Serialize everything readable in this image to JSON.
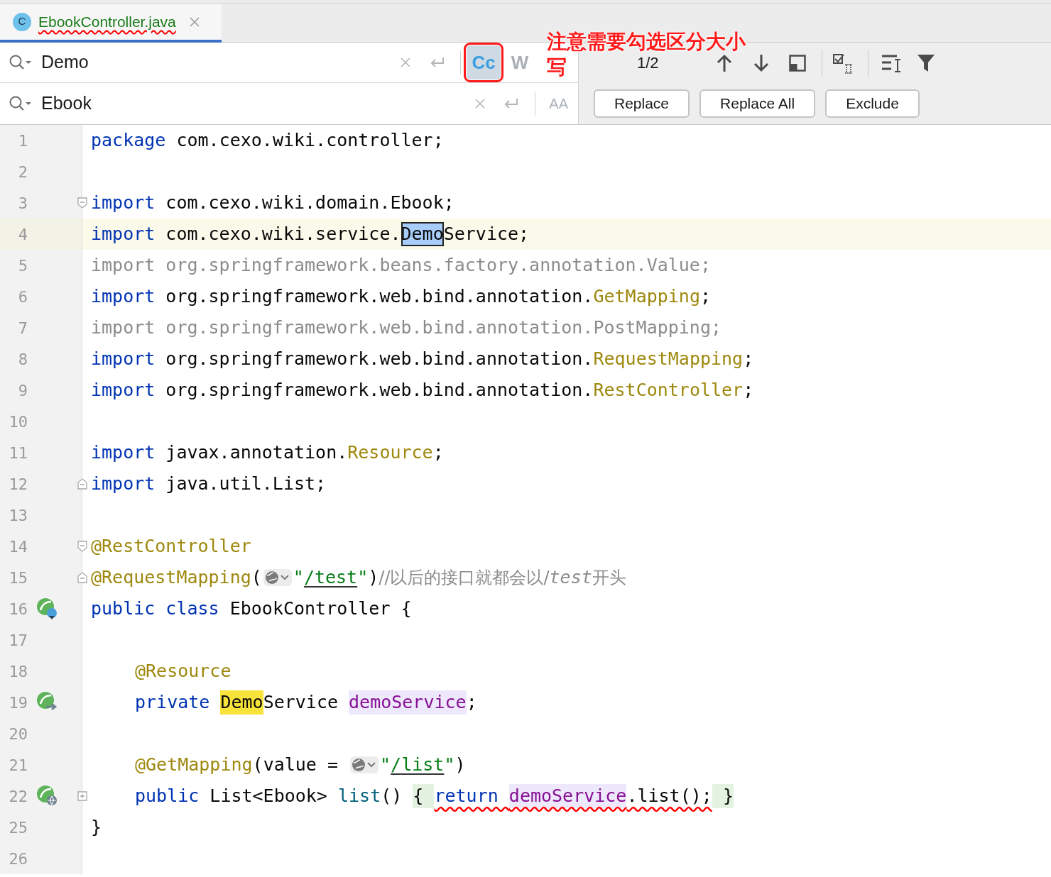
{
  "tab": {
    "icon_letter": "C",
    "label": "EbookController.java",
    "selected": true,
    "squiggle": true
  },
  "search": {
    "value": "Demo",
    "matches": "1/2",
    "options": [
      {
        "label": "Cc",
        "selected": true,
        "outlined": true
      },
      {
        "label": "W",
        "selected": false,
        "outlined": false
      }
    ]
  },
  "replace": {
    "value": "Ebook",
    "preserve_case_label": "AA"
  },
  "buttons": [
    "Replace",
    "Replace All",
    "Exclude"
  ],
  "annotation_lines": [
    "注意需要勾选区分大小",
    "写"
  ],
  "lines": [
    {
      "n": "1",
      "tokens": [
        {
          "text": "package ",
          "kind": "kw"
        },
        {
          "text": "com.cexo.wiki.controller;",
          "kind": "plain"
        }
      ]
    },
    {
      "n": "2"
    },
    {
      "n": "3",
      "fold": {
        "kind": "start"
      },
      "tokens": [
        {
          "text": "import ",
          "kind": "kw"
        },
        {
          "text": "com.cexo.wiki.domain.Ebook;",
          "kind": "plain"
        }
      ]
    },
    {
      "n": "4",
      "current": true,
      "tokens": [
        {
          "text": "import ",
          "kind": "kw"
        },
        {
          "text": "com.cexo.wiki.service.",
          "kind": "plain"
        },
        {
          "text": "Demo",
          "kind": "current-match"
        },
        {
          "text": "Service;",
          "kind": "plain"
        }
      ]
    },
    {
      "n": "5",
      "tokens": [
        {
          "text": "import org.springframework.beans.factory.annotation.Value;",
          "kind": "dim"
        }
      ]
    },
    {
      "n": "6",
      "tokens": [
        {
          "text": "import ",
          "kind": "kw"
        },
        {
          "text": "org.springframework.web.bind.annotation.",
          "kind": "plain"
        },
        {
          "text": "GetMapping",
          "kind": "ann"
        },
        {
          "text": ";",
          "kind": "plain"
        }
      ]
    },
    {
      "n": "7",
      "tokens": [
        {
          "text": "import org.springframework.web.bind.annotation.PostMapping;",
          "kind": "dim"
        }
      ]
    },
    {
      "n": "8",
      "tokens": [
        {
          "text": "import ",
          "kind": "kw"
        },
        {
          "text": "org.springframework.web.bind.annotation.",
          "kind": "plain"
        },
        {
          "text": "RequestMapping",
          "kind": "ann"
        },
        {
          "text": ";",
          "kind": "plain"
        }
      ]
    },
    {
      "n": "9",
      "tokens": [
        {
          "text": "import ",
          "kind": "kw"
        },
        {
          "text": "org.springframework.web.bind.annotation.",
          "kind": "plain"
        },
        {
          "text": "RestController",
          "kind": "ann"
        },
        {
          "text": ";",
          "kind": "plain"
        }
      ]
    },
    {
      "n": "10"
    },
    {
      "n": "11",
      "tokens": [
        {
          "text": "import ",
          "kind": "kw"
        },
        {
          "text": "javax.annotation.",
          "kind": "plain"
        },
        {
          "text": "Resource",
          "kind": "ann"
        },
        {
          "text": ";",
          "kind": "plain"
        }
      ]
    },
    {
      "n": "12",
      "fold": {
        "kind": "end"
      },
      "tokens": [
        {
          "text": "import ",
          "kind": "kw"
        },
        {
          "text": "java.util.List;",
          "kind": "plain"
        }
      ]
    },
    {
      "n": "13"
    },
    {
      "n": "14",
      "fold": {
        "kind": "start"
      },
      "tokens": [
        {
          "text": "@RestController",
          "kind": "ann"
        }
      ]
    },
    {
      "n": "15",
      "fold": {
        "kind": "end"
      },
      "tokens": [
        {
          "text": "@RequestMapping",
          "kind": "ann"
        },
        {
          "text": "(",
          "kind": "plain"
        },
        {
          "kind": "globe"
        },
        {
          "text": "\"",
          "kind": "str"
        },
        {
          "text": "/test",
          "kind": "url"
        },
        {
          "text": "\"",
          "kind": "str"
        },
        {
          "text": ")",
          "kind": "plain"
        },
        {
          "text": "//以后的接口就都会以/",
          "kind": "comment"
        },
        {
          "text": "test",
          "kind": "comment-italic"
        },
        {
          "text": "开头",
          "kind": "comment"
        }
      ]
    },
    {
      "n": "16",
      "marker": {
        "kind": "bean-c"
      },
      "tokens": [
        {
          "text": "public class ",
          "kind": "kw"
        },
        {
          "text": "EbookController {",
          "kind": "plain"
        }
      ]
    },
    {
      "n": "17"
    },
    {
      "n": "18",
      "indent": true,
      "tokens": [
        {
          "text": "@Resource",
          "kind": "ann"
        }
      ]
    },
    {
      "n": "19",
      "marker": {
        "kind": "bean-arrow"
      },
      "indent": true,
      "tokens": [
        {
          "text": "private ",
          "kind": "kw"
        },
        {
          "text": "Demo",
          "kind": "match"
        },
        {
          "text": "Service ",
          "kind": "plain"
        },
        {
          "text": "demoService",
          "kind": "field"
        },
        {
          "text": ";",
          "kind": "plain"
        }
      ]
    },
    {
      "n": "20"
    },
    {
      "n": "21",
      "indent": true,
      "tokens": [
        {
          "text": "@GetMapping",
          "kind": "ann"
        },
        {
          "text": "(value = ",
          "kind": "plain"
        },
        {
          "kind": "globe"
        },
        {
          "text": "\"",
          "kind": "str"
        },
        {
          "text": "/list",
          "kind": "url"
        },
        {
          "text": "\"",
          "kind": "str"
        },
        {
          "text": ")",
          "kind": "plain"
        }
      ]
    },
    {
      "n": "22",
      "marker": {
        "kind": "bean-globe"
      },
      "fold": {
        "kind": "collapsed"
      },
      "indent": true,
      "tokens": [
        {
          "text": "public ",
          "kind": "kw"
        },
        {
          "text": "List<Ebook> ",
          "kind": "plain"
        },
        {
          "text": "list",
          "kind": "method"
        },
        {
          "text": "() ",
          "kind": "plain"
        },
        {
          "text": "{ ",
          "kind": "brace"
        },
        {
          "text": "return ",
          "kind": "kw",
          "squiggle": true
        },
        {
          "text": "demoService",
          "kind": "field",
          "squiggle": true
        },
        {
          "text": ".list();",
          "kind": "plain",
          "squiggle": true
        },
        {
          "text": " }",
          "kind": "brace"
        }
      ]
    },
    {
      "n": "25",
      "tokens": [
        {
          "text": "}",
          "kind": "plain"
        }
      ]
    },
    {
      "n": "26"
    }
  ]
}
